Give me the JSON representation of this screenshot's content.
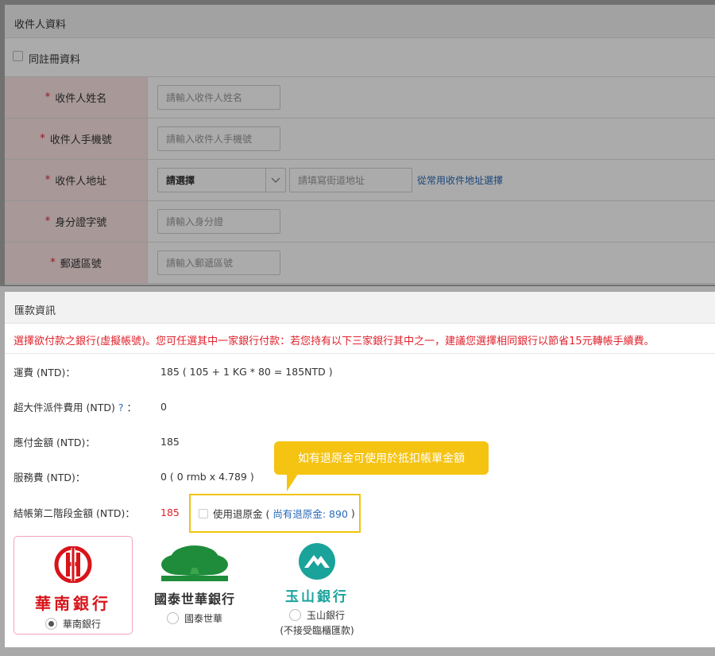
{
  "recipient": {
    "title": "收件人資料",
    "same_as_registration": "同註冊資料",
    "fields": [
      {
        "label": "收件人姓名",
        "placeholder": "請輸入收件人姓名"
      },
      {
        "label": "收件人手機號",
        "placeholder": "請輸入收件人手機號"
      },
      {
        "label": "收件人地址",
        "select_value": "請選擇",
        "placeholder": "請填寫街道地址",
        "link": "從常用收件地址選擇"
      },
      {
        "label": "身分證字號",
        "placeholder": "請輸入身分證"
      },
      {
        "label": "郵遞區號",
        "placeholder": "請輸入郵遞區號"
      }
    ],
    "required_mark": "*"
  },
  "remittance": {
    "title": "匯款資訊",
    "notice": "選擇欲付款之銀行(虛擬帳號)。您可任選其中一家銀行付款：若您持有以下三家銀行其中之一，建議您選擇相同銀行以節省15元轉帳手續費。",
    "fees": [
      {
        "label": "運費 (NTD)：",
        "value": "185 ( 105 + 1 KG * 80 = 185NTD )"
      },
      {
        "label": "超大件派件費用 (NTD)",
        "help": "?",
        "colon": "：",
        "value": "0"
      },
      {
        "label": "應付金額 (NTD)：",
        "value": "185"
      },
      {
        "label": "服務費 (NTD)：",
        "value": "0 ( 0 rmb x 4.789 )"
      },
      {
        "label": "結帳第二階段金額 (NTD)：",
        "value": "185"
      }
    ],
    "use_refund_label": "使用退原金 (",
    "refund_balance": "尚有退原金: 890",
    "refund_close": ")",
    "tooltip": "如有退原金可使用於抵扣帳單金額",
    "banks": [
      {
        "logo_text": "華南銀行",
        "name": "華南銀行",
        "selected": true,
        "note": ""
      },
      {
        "logo_text": "國泰世華銀行",
        "name": "國泰世華",
        "selected": false,
        "note": ""
      },
      {
        "logo_text": "玉山銀行",
        "name": "玉山銀行",
        "selected": false,
        "note": "(不接受臨櫃匯款)"
      }
    ]
  },
  "colors": {
    "required": "#e0212b",
    "label_bg": "#fbe3e3",
    "link": "#2a6ab8",
    "tooltip": "#f5c312",
    "hua_nan": "#d7141a",
    "cathay": "#1e8c3a",
    "esun": "#1aa39b"
  }
}
